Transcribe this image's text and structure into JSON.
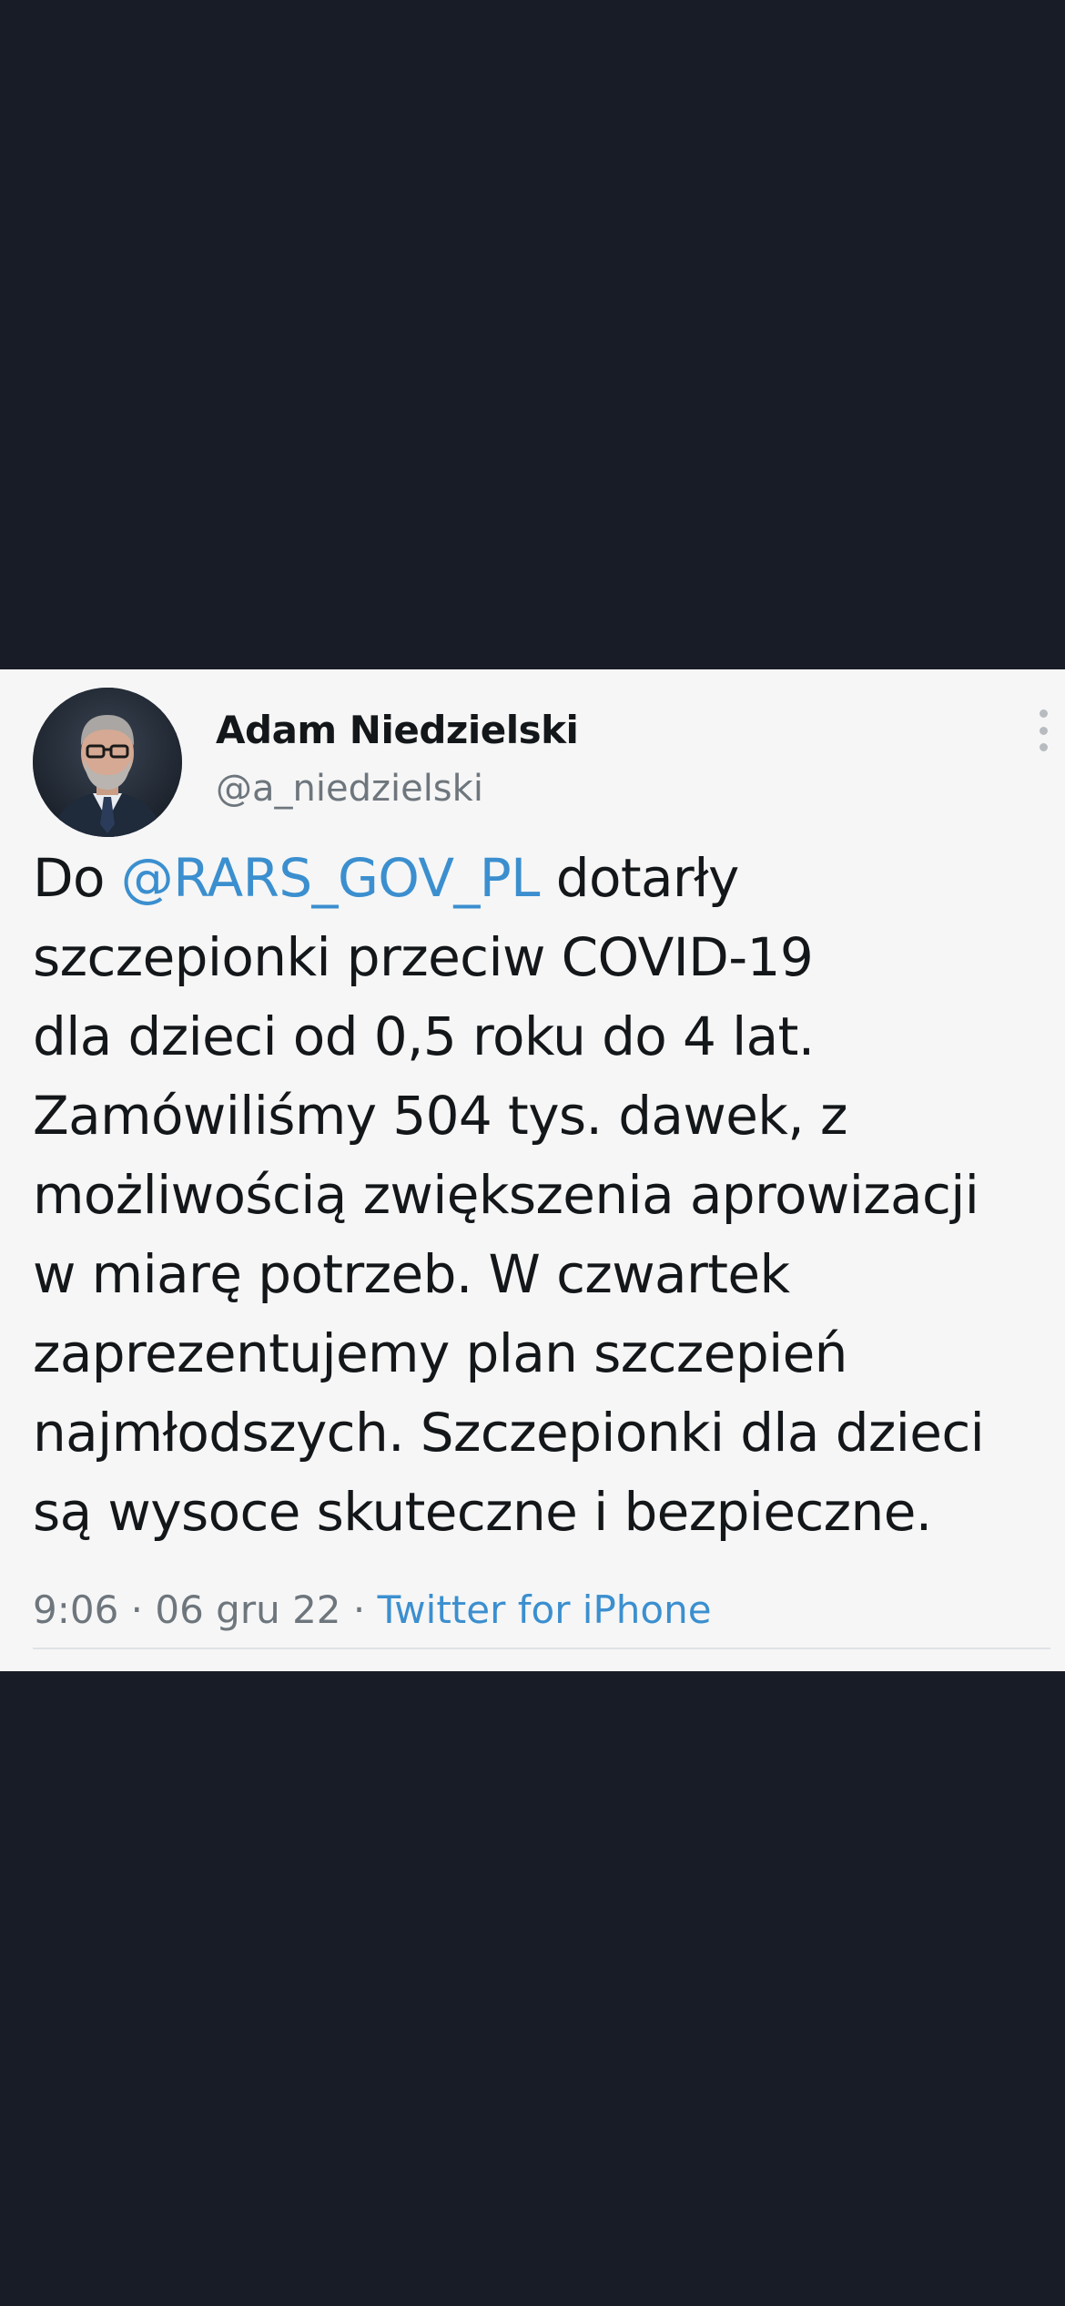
{
  "tweet": {
    "author": {
      "name": "Adam Niedzielski",
      "handle": "@a_niedzielski"
    },
    "text": {
      "line1_prefix": "Do ",
      "line1_mention": "@RARS_GOV_PL",
      "line1_suffix": " dotarły",
      "line2": "szczepionki przeciw COVID-19",
      "line3": "dla dzieci od 0,5 roku do 4 lat.",
      "line4": "Zamówiliśmy 504 tys. dawek, z",
      "line5": "możliwością zwiększenia aprowizacji",
      "line6": "w miarę potrzeb. W czwartek",
      "line7": "zaprezentujemy plan szczepień",
      "line8": "najmłodszych. Szczepionki dla dzieci",
      "line9": "są wysoce skuteczne i bezpieczne."
    },
    "meta": {
      "time": "9:06",
      "separator": " · ",
      "date": "06 gru 22",
      "source": "Twitter for iPhone"
    }
  },
  "colors": {
    "background": "#181c27",
    "card": "#f6f6f6",
    "link": "#3b8fcf",
    "text": "#14171a",
    "muted": "#6e767d"
  },
  "icons": {
    "more": "more-vertical-icon"
  }
}
